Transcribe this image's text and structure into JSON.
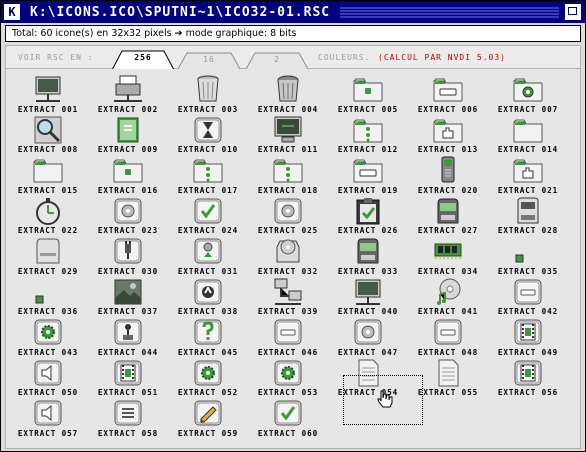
{
  "window": {
    "title": "K:\\ICONS.ICO\\SPUTNI~1\\ICO32-01.RSC"
  },
  "info": "Total: 60 icone(s) en 32x32 pixels ➔ mode graphique: 8 bits",
  "toolbar": {
    "voir_label": "VOIR RSC EN :",
    "tabs": [
      "256",
      "16",
      "2"
    ],
    "active_tab": "256",
    "couleurs_label": "COULEURS.",
    "calc_label": "(CALCUL PAR NVDI 5.03)"
  },
  "colors": {
    "title_bg": "#000080",
    "accent_red": "#c00000",
    "folder_green": "#3c9a3c"
  },
  "icons": [
    {
      "label": "EXTRACT 001",
      "icon": "monitor-network-icon"
    },
    {
      "label": "EXTRACT 002",
      "icon": "printer-network-icon"
    },
    {
      "label": "EXTRACT 003",
      "icon": "trash-empty-icon"
    },
    {
      "label": "EXTRACT 004",
      "icon": "trash-full-icon"
    },
    {
      "label": "EXTRACT 005",
      "icon": "folder-icon"
    },
    {
      "label": "EXTRACT 006",
      "icon": "folder-drive-icon"
    },
    {
      "label": "EXTRACT 007",
      "icon": "folder-gear-icon"
    },
    {
      "label": "EXTRACT 008",
      "icon": "magnifier-icon"
    },
    {
      "label": "EXTRACT 009",
      "icon": "book-icon"
    },
    {
      "label": "EXTRACT 010",
      "icon": "hourglass-icon"
    },
    {
      "label": "EXTRACT 011",
      "icon": "monitor-icon"
    },
    {
      "label": "EXTRACT 012",
      "icon": "folder-buttons-icon"
    },
    {
      "label": "EXTRACT 013",
      "icon": "folder-hand-icon"
    },
    {
      "label": "EXTRACT 014",
      "icon": "folder-plain-icon"
    },
    {
      "label": "EXTRACT 015",
      "icon": "folder-plain-icon"
    },
    {
      "label": "EXTRACT 016",
      "icon": "folder-icon"
    },
    {
      "label": "EXTRACT 017",
      "icon": "folder-buttons-icon"
    },
    {
      "label": "EXTRACT 018",
      "icon": "folder-buttons-icon"
    },
    {
      "label": "EXTRACT 019",
      "icon": "folder-drive-icon"
    },
    {
      "label": "EXTRACT 020",
      "icon": "folder-phone-icon"
    },
    {
      "label": "EXTRACT 021",
      "icon": "folder-hand-icon"
    },
    {
      "label": "EXTRACT 022",
      "icon": "stopwatch-icon"
    },
    {
      "label": "EXTRACT 023",
      "icon": "box-disc-icon"
    },
    {
      "label": "EXTRACT 024",
      "icon": "box-check-icon"
    },
    {
      "label": "EXTRACT 025",
      "icon": "box-disc-icon"
    },
    {
      "label": "EXTRACT 026",
      "icon": "clipboard-check-icon"
    },
    {
      "label": "EXTRACT 027",
      "icon": "drive-green-icon"
    },
    {
      "label": "EXTRACT 028",
      "icon": "drive-floppy-icon"
    },
    {
      "label": "EXTRACT 029",
      "icon": "drive-grey-icon"
    },
    {
      "label": "EXTRACT 030",
      "icon": "box-plug-icon"
    },
    {
      "label": "EXTRACT 031",
      "icon": "box-recycle-icon"
    },
    {
      "label": "EXTRACT 032",
      "icon": "drive-cd-icon"
    },
    {
      "label": "EXTRACT 033",
      "icon": "drive-green-icon"
    },
    {
      "label": "EXTRACT 034",
      "icon": "memory-chip-icon"
    },
    {
      "label": "EXTRACT 035",
      "icon": "small-square-icon"
    },
    {
      "label": "EXTRACT 036",
      "icon": "small-square-icon"
    },
    {
      "label": "EXTRACT 037",
      "icon": "photo-icon"
    },
    {
      "label": "EXTRACT 038",
      "icon": "box-logo-icon"
    },
    {
      "label": "EXTRACT 039",
      "icon": "network-computers-icon"
    },
    {
      "label": "EXTRACT 040",
      "icon": "monitor-network-icon"
    },
    {
      "label": "EXTRACT 041",
      "icon": "cd-music-icon"
    },
    {
      "label": "EXTRACT 042",
      "icon": "box-slot-icon"
    },
    {
      "label": "EXTRACT 043",
      "icon": "box-gear-icon"
    },
    {
      "label": "EXTRACT 044",
      "icon": "box-joystick-icon"
    },
    {
      "label": "EXTRACT 045",
      "icon": "box-question-icon"
    },
    {
      "label": "EXTRACT 046",
      "icon": "box-slot-icon"
    },
    {
      "label": "EXTRACT 047",
      "icon": "box-disc-icon"
    },
    {
      "label": "EXTRACT 048",
      "icon": "box-slot-icon"
    },
    {
      "label": "EXTRACT 049",
      "icon": "box-film-icon"
    },
    {
      "label": "EXTRACT 050",
      "icon": "box-speaker-icon"
    },
    {
      "label": "EXTRACT 051",
      "icon": "box-film-icon"
    },
    {
      "label": "EXTRACT 052",
      "icon": "box-gear-icon"
    },
    {
      "label": "EXTRACT 053",
      "icon": "box-gear-icon"
    },
    {
      "label": "EXTRACT 054",
      "icon": "document-icon"
    },
    {
      "label": "EXTRACT 055",
      "icon": "document-icon"
    },
    {
      "label": "EXTRACT 056",
      "icon": "box-film-icon"
    },
    {
      "label": "EXTRACT 057",
      "icon": "box-speaker-icon"
    },
    {
      "label": "EXTRACT 058",
      "icon": "box-text-icon"
    },
    {
      "label": "EXTRACT 059",
      "icon": "box-pencil-icon"
    },
    {
      "label": "EXTRACT 060",
      "icon": "box-check-icon"
    }
  ],
  "cursor": {
    "icon": "hand-cursor-icon"
  }
}
